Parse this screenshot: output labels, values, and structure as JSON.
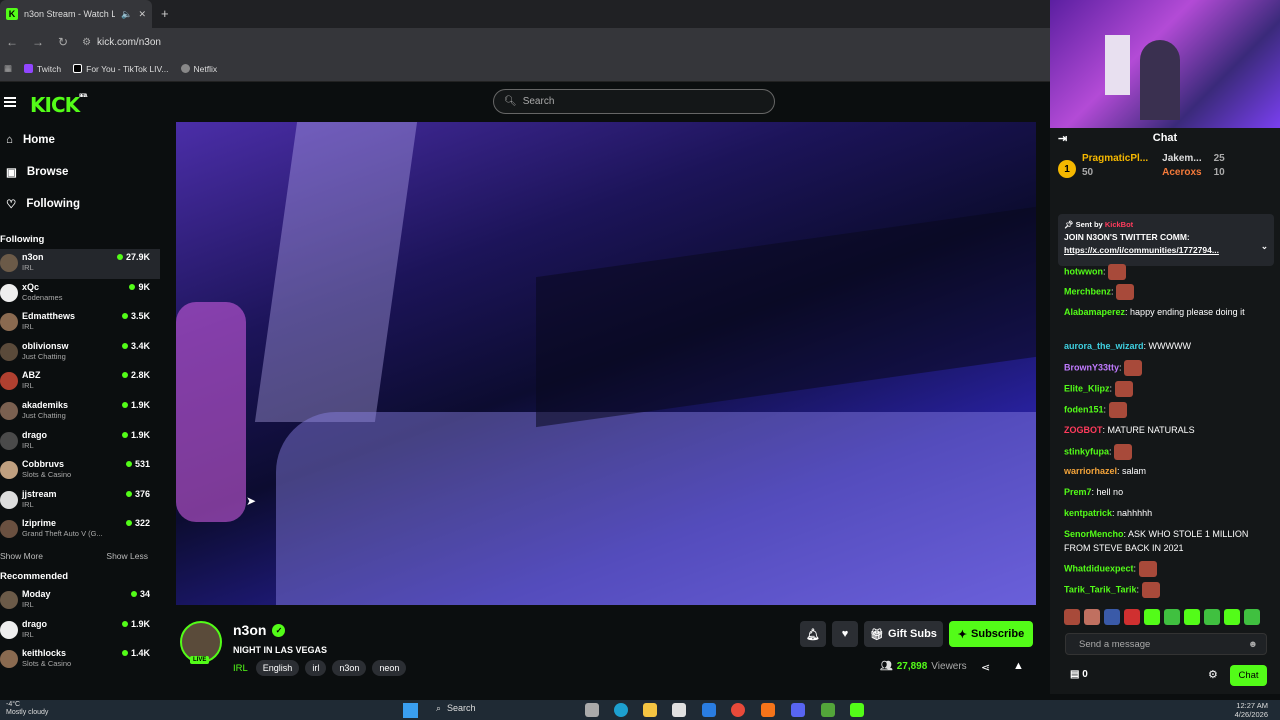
{
  "browser": {
    "tab_title": "n3on Stream - Watch Live on...",
    "url": "kick.com/n3on",
    "bookmarks": [
      "Twitch",
      "For You - TikTok LIV...",
      "Netflix"
    ]
  },
  "header": {
    "logo": "KICK",
    "logo_badge": "BETA",
    "search_placeholder": "Search"
  },
  "sidebar": {
    "nav": [
      {
        "label": "Home",
        "icon": "home-icon"
      },
      {
        "label": "Browse",
        "icon": "browse-icon"
      },
      {
        "label": "Following",
        "icon": "heart-icon"
      }
    ],
    "following_title": "Following",
    "following": [
      {
        "name": "n3on",
        "category": "IRL",
        "viewers": "27.9K"
      },
      {
        "name": "xQc",
        "category": "Codenames",
        "viewers": "9K"
      },
      {
        "name": "Edmatthews",
        "category": "IRL",
        "viewers": "3.5K"
      },
      {
        "name": "oblivionsw",
        "category": "Just Chatting",
        "viewers": "3.4K"
      },
      {
        "name": "ABZ",
        "category": "IRL",
        "viewers": "2.8K"
      },
      {
        "name": "akademiks",
        "category": "Just Chatting",
        "viewers": "1.9K"
      },
      {
        "name": "drago",
        "category": "IRL",
        "viewers": "1.9K"
      },
      {
        "name": "Cobbruvs",
        "category": "Slots & Casino",
        "viewers": "531"
      },
      {
        "name": "jjstream",
        "category": "IRL",
        "viewers": "376"
      },
      {
        "name": "lziprime",
        "category": "Grand Theft Auto V (G...",
        "viewers": "322"
      }
    ],
    "show_more": "Show More",
    "show_less": "Show Less",
    "recommended_title": "Recommended",
    "recommended": [
      {
        "name": "Moday",
        "category": "IRL",
        "viewers": "34"
      },
      {
        "name": "drago",
        "category": "IRL",
        "viewers": "1.9K"
      },
      {
        "name": "keithlocks",
        "category": "Slots & Casino",
        "viewers": "1.4K"
      }
    ]
  },
  "stream": {
    "streamer": "n3on",
    "live_badge": "LIVE",
    "title": "NIGHT IN LAS VEGAS",
    "category": "IRL",
    "tags": [
      "English",
      "irl",
      "n3on",
      "neon"
    ],
    "viewers": "27,898",
    "viewers_label": "Viewers",
    "gift_subs": "Gift Subs",
    "subscribe": "Subscribe"
  },
  "chat": {
    "title": "Chat",
    "leaderboard": [
      {
        "rank": "1",
        "name": "PragmaticPl...",
        "count": "50"
      },
      {
        "name": "Jakem...",
        "count": "25"
      },
      {
        "name": "Aceroxs",
        "count": "10"
      }
    ],
    "pinned": {
      "sent_by": "Sent by",
      "sender": "KickBot",
      "line1": "JOIN N3ON'S TWITTER COMM:",
      "line2": "https://x.com/i/communities/1772794..."
    },
    "messages": [
      {
        "user": "hotwwon",
        "text": "",
        "color": "#53fc18"
      },
      {
        "user": "Merchbenz",
        "text": "",
        "color": "#53fc18"
      },
      {
        "user": "Alabamaperez",
        "text": "happy ending please doing it",
        "color": "#53fc18"
      },
      {
        "user": "aurora_the_wizard",
        "text": "WWWWW",
        "color": "#3fd0e0"
      },
      {
        "user": "BrownY33tty",
        "text": "",
        "color": "#c17bff"
      },
      {
        "user": "Elite_Klipz",
        "text": "",
        "color": "#53fc18"
      },
      {
        "user": "foden151",
        "text": "",
        "color": "#53fc18"
      },
      {
        "user": "ZOGBOT",
        "text": "MATURE NATURALS",
        "color": "#ff3b5c"
      },
      {
        "user": "stinkyfupa",
        "text": "",
        "color": "#53fc18"
      },
      {
        "user": "warriorhazel",
        "text": "salam",
        "color": "#f2a33a"
      },
      {
        "user": "Prem7",
        "text": "hell no",
        "color": "#53fc18"
      },
      {
        "user": "kentpatrick",
        "text": "nahhhhh",
        "color": "#53fc18"
      },
      {
        "user": "SenorMencho",
        "text": "ASK WHO STOLE 1 MILLION FROM STEVE BACK IN 2021",
        "color": "#53fc18"
      },
      {
        "user": "Whatdiduexpect",
        "text": "",
        "color": "#53fc18"
      },
      {
        "user": "Tarik_Tarik_Tarik",
        "text": "",
        "color": "#53fc18"
      }
    ],
    "input_placeholder": "Send a message",
    "points": "0",
    "send_label": "Chat"
  },
  "taskbar": {
    "weather_temp": "-4°C",
    "weather_desc": "Mostly cloudy",
    "search": "Search",
    "time": "12:27 AM",
    "date": "4/26/2026"
  }
}
